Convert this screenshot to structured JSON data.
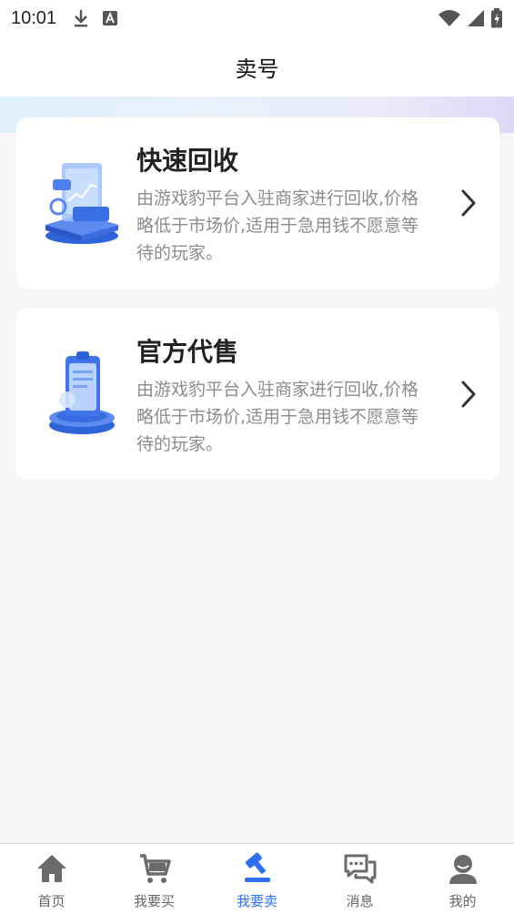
{
  "status_bar": {
    "time": "10:01",
    "icons_left": [
      "download-icon",
      "a-letter-icon"
    ],
    "icons_right": [
      "wifi-icon",
      "signal-icon",
      "battery-icon"
    ]
  },
  "header": {
    "title": "卖号"
  },
  "options": [
    {
      "title": "快速回收",
      "description": "由游戏豹平台入驻商家进行回收,价格略低于市场价,适用于急用钱不愿意等待的玩家。",
      "icon": "chart-tablet-illustration"
    },
    {
      "title": "官方代售",
      "description": "由游戏豹平台入驻商家进行回收,价格略低于市场价,适用于急用钱不愿意等待的玩家。",
      "icon": "clipboard-illustration"
    }
  ],
  "tabbar": {
    "active_index": 2,
    "active_color": "#2e6ff0",
    "items": [
      {
        "label": "首页",
        "icon": "home-icon"
      },
      {
        "label": "我要买",
        "icon": "cart-icon"
      },
      {
        "label": "我要卖",
        "icon": "gavel-icon"
      },
      {
        "label": "消息",
        "icon": "chat-icon"
      },
      {
        "label": "我的",
        "icon": "user-icon"
      }
    ]
  }
}
